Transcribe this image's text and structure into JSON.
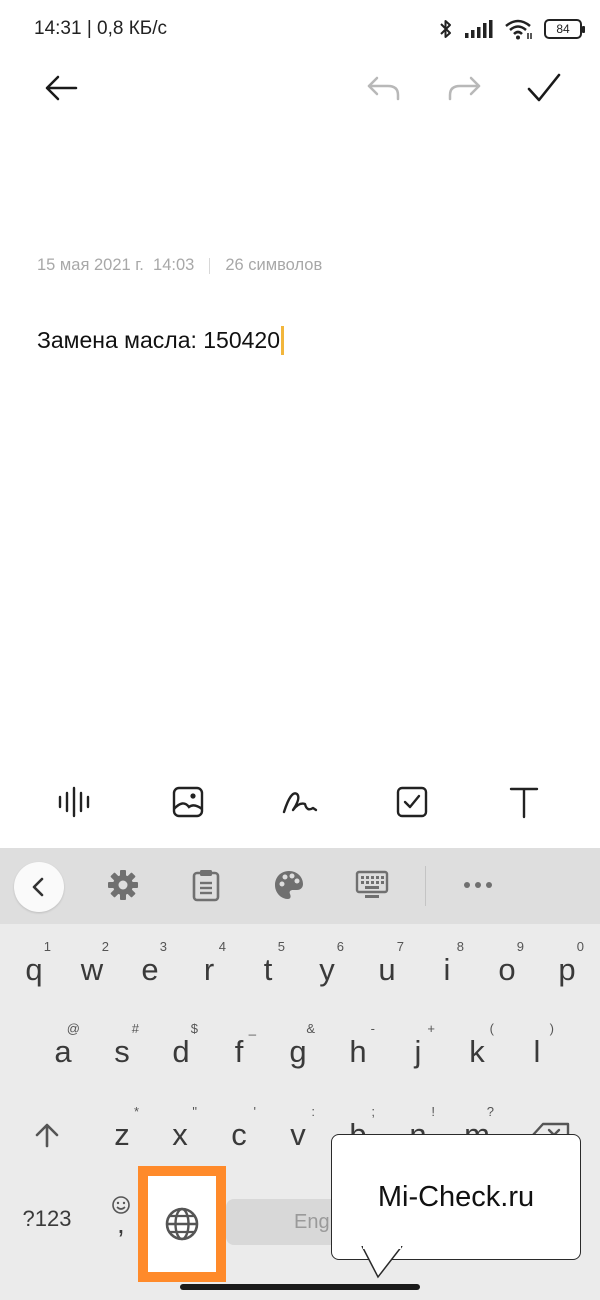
{
  "status_bar": {
    "time_speed": "14:31 | 0,8 КБ/с",
    "battery": "84"
  },
  "toolbar": {
    "back_icon": "arrow-left-icon",
    "undo_icon": "undo-icon",
    "redo_icon": "redo-icon",
    "done_icon": "checkmark-icon"
  },
  "note": {
    "date": "15 мая 2021 г.  14:03",
    "char_count": "26 символов",
    "text": "Замена масла: 150420"
  },
  "format_bar": {
    "icons": [
      "audio-wave-icon",
      "image-icon",
      "handwriting-icon",
      "checkbox-icon",
      "text-format-icon"
    ]
  },
  "keyboard": {
    "tools": [
      "chevron-left-icon",
      "settings-icon",
      "clipboard-icon",
      "palette-icon",
      "keyboard-icon",
      "more-icon"
    ],
    "row1": [
      {
        "key": "q",
        "hint": "1"
      },
      {
        "key": "w",
        "hint": "2"
      },
      {
        "key": "e",
        "hint": "3"
      },
      {
        "key": "r",
        "hint": "4"
      },
      {
        "key": "t",
        "hint": "5"
      },
      {
        "key": "y",
        "hint": "6"
      },
      {
        "key": "u",
        "hint": "7"
      },
      {
        "key": "i",
        "hint": "8"
      },
      {
        "key": "o",
        "hint": "9"
      },
      {
        "key": "p",
        "hint": "0"
      }
    ],
    "row2": [
      {
        "key": "a",
        "hint": "@"
      },
      {
        "key": "s",
        "hint": "#"
      },
      {
        "key": "d",
        "hint": "$"
      },
      {
        "key": "f",
        "hint": "_"
      },
      {
        "key": "g",
        "hint": "&"
      },
      {
        "key": "h",
        "hint": "-"
      },
      {
        "key": "j",
        "hint": "+"
      },
      {
        "key": "k",
        "hint": "("
      },
      {
        "key": "l",
        "hint": ")"
      }
    ],
    "row3": [
      {
        "key": "z",
        "hint": "*"
      },
      {
        "key": "x",
        "hint": "\""
      },
      {
        "key": "c",
        "hint": "'"
      },
      {
        "key": "v",
        "hint": ":"
      },
      {
        "key": "b",
        "hint": ";"
      },
      {
        "key": "n",
        "hint": "!"
      },
      {
        "key": "m",
        "hint": "?"
      }
    ],
    "symbols_label": "?123",
    "comma": ",",
    "space_label": "Eng"
  },
  "callout": {
    "text": "Mi-Check.ru"
  },
  "colors": {
    "highlight": "#ff8a2a",
    "caret": "#f2b63c"
  }
}
